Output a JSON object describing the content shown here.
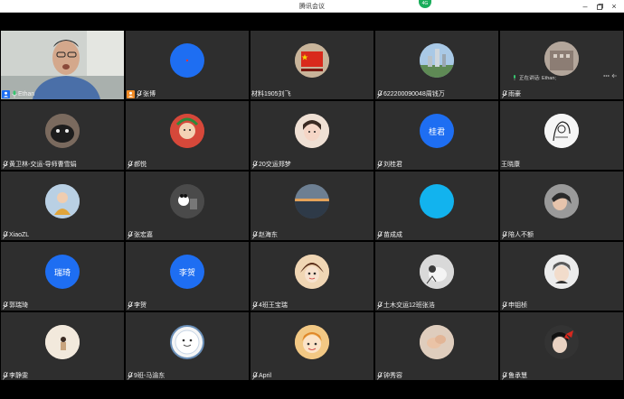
{
  "window": {
    "title": "腾讯会议",
    "network_badge": "4G"
  },
  "colors": {
    "tile_bg": "#2e2e2e",
    "accent_blue": "#1e6ef2",
    "cyan_avatar": "#12b3ee"
  },
  "host": {
    "name": "Ethan"
  },
  "participants": [
    {
      "name": "张博"
    },
    {
      "name": "材料1905刘飞"
    },
    {
      "name": "622200090048周钱万"
    },
    {
      "name": "雨豪",
      "speaking_label": "正在讲话: Ethan;"
    },
    {
      "name": "黄卫林-交运-导师曹雪娟"
    },
    {
      "name": "郝悦"
    },
    {
      "name": "20交运郑梦"
    },
    {
      "name": "刘桂君",
      "avatar_text": "桂君"
    },
    {
      "name": "王晓康"
    },
    {
      "name": "XiaoZL"
    },
    {
      "name": "张宏嘉"
    },
    {
      "name": "赵海东"
    },
    {
      "name": "苗成成"
    },
    {
      "name": "陪人不额"
    },
    {
      "name": "郭瑞琦",
      "avatar_text": "瑞琦"
    },
    {
      "name": "李贺",
      "avatar_text": "李贺"
    },
    {
      "name": "4班王宝瑞"
    },
    {
      "name": "土木交运12班张浩"
    },
    {
      "name": "申钼桢"
    },
    {
      "name": "李静雯"
    },
    {
      "name": "9班-马渝东"
    },
    {
      "name": "April"
    },
    {
      "name": "钟秀容"
    },
    {
      "name": "鲁承慧"
    }
  ]
}
